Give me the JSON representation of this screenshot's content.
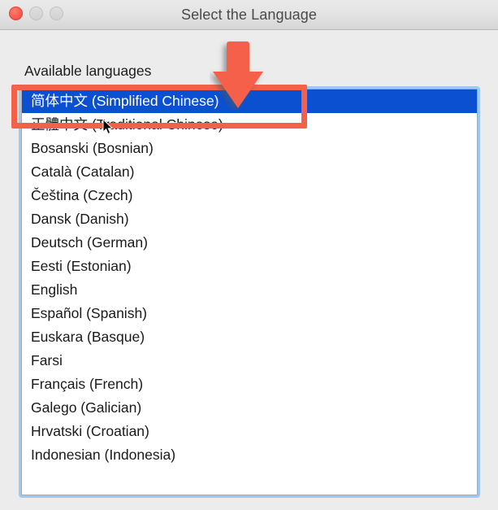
{
  "window": {
    "title": "Select the Language",
    "traffic_lights": [
      {
        "name": "close",
        "state": "active",
        "color": "#fb5c4d"
      },
      {
        "name": "minimize",
        "state": "disabled",
        "color": "#d6d6d6"
      },
      {
        "name": "maximize",
        "state": "disabled",
        "color": "#d6d6d6"
      }
    ],
    "background_color": "#ececec"
  },
  "main": {
    "label": "Available languages",
    "list": {
      "selected_index": 0,
      "selection_color": "#0a50d0",
      "selection_text_color": "#ffffff",
      "focus_ring_color": "#9ec8f0",
      "items": [
        {
          "label": "简体中文 (Simplified Chinese)",
          "selected": true
        },
        {
          "label": "正體中文 (Traditional Chinese)",
          "selected": false
        },
        {
          "label": "Bosanski (Bosnian)",
          "selected": false
        },
        {
          "label": "Català (Catalan)",
          "selected": false
        },
        {
          "label": "Čeština (Czech)",
          "selected": false
        },
        {
          "label": "Dansk (Danish)",
          "selected": false
        },
        {
          "label": "Deutsch (German)",
          "selected": false
        },
        {
          "label": "Eesti (Estonian)",
          "selected": false
        },
        {
          "label": "English",
          "selected": false
        },
        {
          "label": "Español (Spanish)",
          "selected": false
        },
        {
          "label": "Euskara (Basque)",
          "selected": false
        },
        {
          "label": "Farsi",
          "selected": false
        },
        {
          "label": "Français (French)",
          "selected": false
        },
        {
          "label": "Galego (Galician)",
          "selected": false
        },
        {
          "label": "Hrvatski (Croatian)",
          "selected": false
        },
        {
          "label": "Indonesian (Indonesia)",
          "selected": false
        }
      ]
    }
  },
  "annotations": {
    "color": "#f4604a",
    "highlight_rect_target": "简体中文 (Simplified Chinese)",
    "arrow_direction": "down"
  }
}
